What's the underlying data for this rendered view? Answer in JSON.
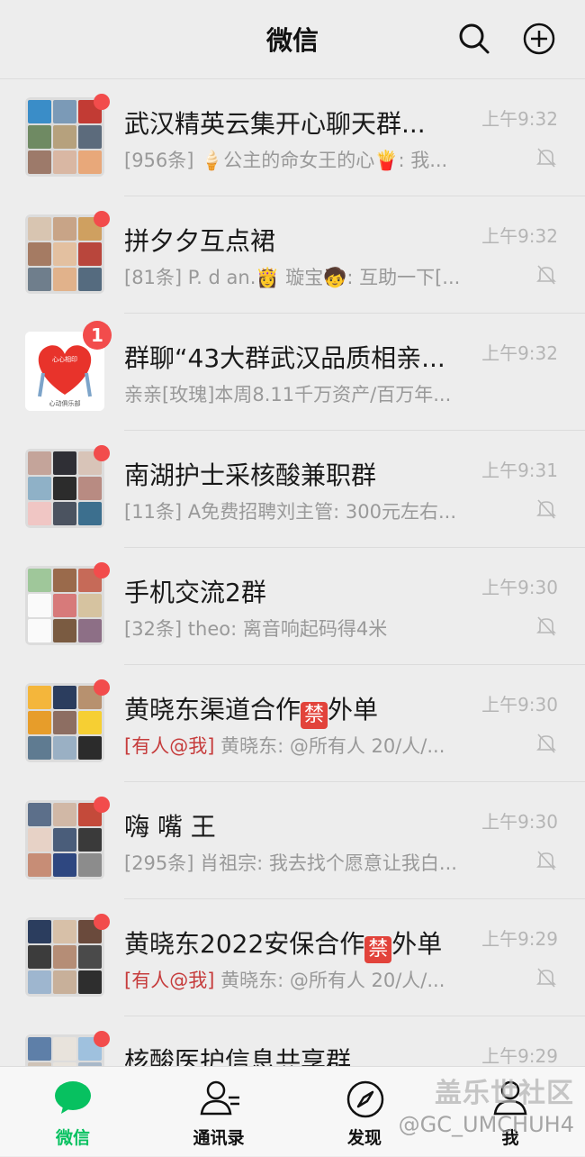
{
  "header": {
    "title": "微信"
  },
  "chats": [
    {
      "name": "武汉精英云集开心聊天群...",
      "preview": "[956条] 🍦公主的命女王的心🍟: 我...",
      "time": "上午9:32",
      "colors": [
        "#3a8dc8",
        "#7b9ab7",
        "#c23b34",
        "#6f8a63",
        "#b6a17d",
        "#5c6b7c",
        "#9d7a6a",
        "#d9b7a3",
        "#e8a87a"
      ]
    },
    {
      "name": "拼夕夕互点裙",
      "preview": "[81条] P. d an.👸 璇宝🧒: 互助一下[...",
      "time": "上午9:32",
      "colors": [
        "#d8c5b1",
        "#c8a487",
        "#cfa060",
        "#a57b63",
        "#e3c0a0",
        "#b9463c",
        "#6f7e8c",
        "#e1b28b",
        "#556b7f"
      ]
    },
    {
      "name": "群聊“43大群武汉品质相亲...",
      "preview": "亲亲[玫瑰]本周8.11千万资产/百万年...",
      "time": "上午9:32",
      "unread": "1"
    },
    {
      "name": "南湖护士采核酸兼职群",
      "preview": "[11条] A免费招聘刘主管: 300元左右...",
      "time": "上午9:31",
      "colors": [
        "#c4a49a",
        "#2f2f35",
        "#d8c4b8",
        "#8fb1c7",
        "#2c2c2c",
        "#b88b82",
        "#f0c6c4",
        "#4b5360",
        "#3c6f8e"
      ]
    },
    {
      "name": "手机交流2群",
      "preview": "[32条] theo: 离音响起码得4米",
      "time": "上午9:30",
      "colors": [
        "#9fc79a",
        "#9a6a4b",
        "#c66a58",
        "#fafafa",
        "#d77a7a",
        "#d6c3a0",
        "#fafafa",
        "#7a5b41",
        "#8d6f86"
      ]
    },
    {
      "name_pre": "黄晓东渠道合作",
      "ban": "禁",
      "name_post": "外单",
      "mention": "[有人@我]",
      "preview": " 黄晓东: @所有人  20/人/...",
      "time": "上午9:30",
      "colors": [
        "#f4b63b",
        "#2b3d5e",
        "#b7916f",
        "#e79d2a",
        "#8d6e62",
        "#f6cf33",
        "#5f7b91",
        "#9ab0c4",
        "#2b2b2b"
      ]
    },
    {
      "name": "嗨 嘴 王",
      "preview": "[295条] 肖祖宗: 我去找个愿意让我白...",
      "time": "上午9:30",
      "colors": [
        "#5c6f8a",
        "#d1b8a6",
        "#c44a3a",
        "#e7d2c6",
        "#4a5d7a",
        "#3a3a3a",
        "#c78d76",
        "#2e4780",
        "#8c8c8c"
      ]
    },
    {
      "name_pre": "黄晓东2022安保合作",
      "ban": "禁",
      "name_post": "外单",
      "mention": "[有人@我]",
      "preview": " 黄晓东: @所有人 20/人/...",
      "time": "上午9:29",
      "colors": [
        "#2b3d5e",
        "#d7c0a8",
        "#6a4a3c",
        "#3c3c3c",
        "#b58d76",
        "#4a4a4a",
        "#9eb6cf",
        "#c8b09a",
        "#2e2e2e"
      ]
    },
    {
      "name": "核酸医护信息共享群",
      "preview": "",
      "time": "上午9:29",
      "colors": [
        "#5e7fa8",
        "#e8e3dc",
        "#9fc1de",
        "#cfc3b7",
        "#e8e3dc",
        "#a8b8c8",
        "#d9d3cc",
        "#b9c9d8",
        "#e0dad3"
      ]
    }
  ],
  "heart_text_top": "心心相印",
  "heart_text_bottom": "心动俱乐部",
  "tabs": [
    {
      "label": "微信"
    },
    {
      "label": "通讯录"
    },
    {
      "label": "发现"
    },
    {
      "label": "我"
    }
  ],
  "watermark": {
    "line1": "盖乐世社区",
    "line2": "@GC_UMCHUH4"
  },
  "theme": {
    "accent": "#07c160",
    "badge": "#f24c4c"
  }
}
